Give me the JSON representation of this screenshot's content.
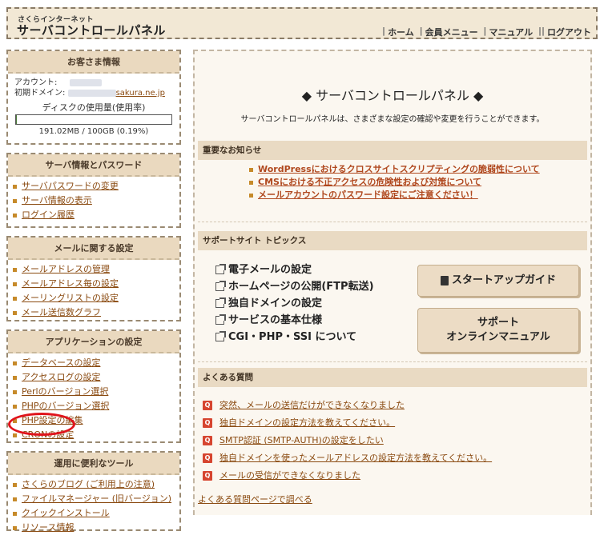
{
  "header": {
    "brand_small": "さくらインターネット",
    "brand_main": "サーバコントロールパネル",
    "nav": [
      "ホーム",
      "会員メニュー",
      "マニュアル",
      "ログアウト"
    ]
  },
  "sidebar": {
    "customer": {
      "title": "お客さま情報",
      "account_label": "アカウント:",
      "domain_label": "初期ドメイン:",
      "domain_suffix": "sakura.ne.jp",
      "disk_label": "ディスクの使用量(使用率)",
      "disk_usage_fraction": 0.0019,
      "disk_value": "191.02MB / 100GB (0.19%)"
    },
    "server": {
      "title": "サーバ情報とパスワード",
      "items": [
        "サーバパスワードの変更",
        "サーバ情報の表示",
        "ログイン履歴"
      ]
    },
    "mail": {
      "title": "メールに関する設定",
      "items": [
        "メールアドレスの管理",
        "メールアドレス毎の設定",
        "メーリングリストの設定",
        "メール送信数グラフ"
      ]
    },
    "apps": {
      "title": "アプリケーションの設定",
      "items": [
        "データベースの設定",
        "アクセスログの設定",
        "Perlのバージョン選択",
        "PHPのバージョン選択",
        "PHP設定の編集",
        "CRONの設定"
      ]
    },
    "tools": {
      "title": "運用に便利なツール",
      "items": [
        "さくらのブログ (ご利用上の注意)",
        "ファイルマネージャー (旧バージョン)",
        "クイックインストール",
        "リソース情報"
      ]
    }
  },
  "main": {
    "title": "◆ サーバコントロールパネル ◆",
    "description": "サーバコントロールパネルは、さまざまな設定の確認や変更を行うことができます。",
    "news": {
      "title": "重要なお知らせ",
      "items": [
        "WordPressにおけるクロスサイトスクリプティングの脆弱性について",
        "CMSにおける不正アクセスの危険性および対策について",
        "メールアカウントのパスワード設定にご注意ください！"
      ]
    },
    "topics": {
      "title": "サポートサイト トピックス",
      "items": [
        "電子メールの設定",
        "ホームページの公開(FTP転送)",
        "独自ドメインの設定",
        "サービスの基本仕様",
        "CGI・PHP・SSI について"
      ],
      "startup_button": "スタートアップガイド",
      "manual_button_line1": "サポート",
      "manual_button_line2": "オンラインマニュアル"
    },
    "faq": {
      "title": "よくある質問",
      "badge": "Q",
      "items": [
        "突然、メールの送信だけができなくなりました",
        "独自ドメインの設定方法を教えてください。",
        "SMTP認証 (SMTP-AUTH)の設定をしたい",
        "独自ドメインを使ったメールアドレスの設定方法を教えてください。",
        "メールの受信ができなくなりました"
      ],
      "more": "よくある質問ページで調べる"
    }
  }
}
